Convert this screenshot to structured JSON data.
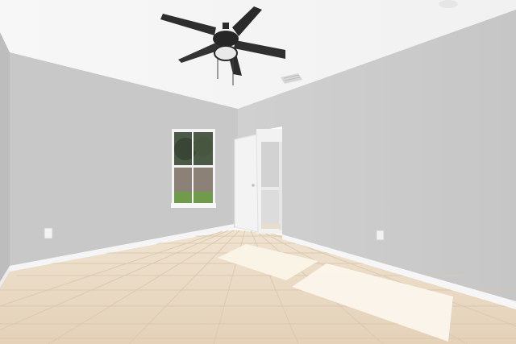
{
  "scene": {
    "subject": "empty-bedroom-interior",
    "elements": [
      "ceiling",
      "ceiling-fan",
      "air-vent",
      "smoke-detector",
      "left-wall",
      "back-wall",
      "right-wall",
      "window",
      "open-door",
      "closet",
      "baseboards",
      "electrical-outlets",
      "tile-floor",
      "sunlight-patches"
    ]
  },
  "colors": {
    "ceiling": "#f4f4f4",
    "walls": "#c9c9c9",
    "wall_shadow": "#b9b9b9",
    "right_wall": "#cbcbcb",
    "baseboard": "#f6f6f6",
    "floor": "#e9d9c3",
    "floor_grout": "#d8c7b0",
    "sunlight": "#fbf5ea",
    "fan_body": "#2b2b2b",
    "door": "#f3f3f3",
    "window_tree": "#3d4a3a",
    "window_fence": "#8a7f74",
    "window_grass": "#6e9a4a"
  }
}
